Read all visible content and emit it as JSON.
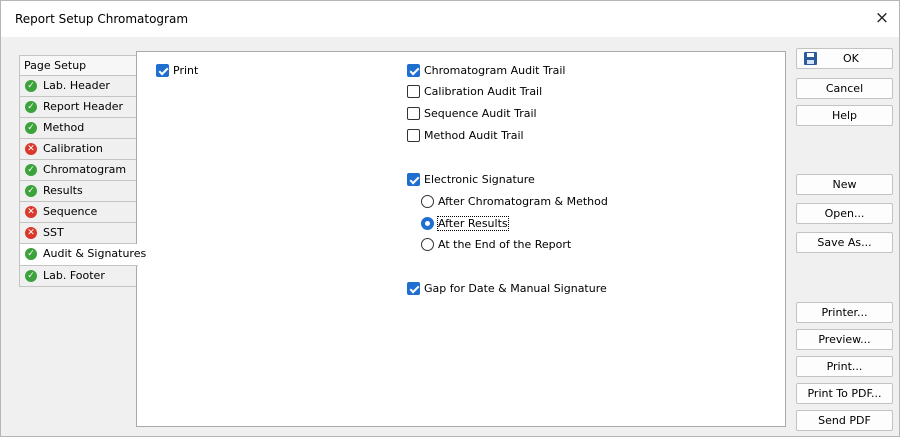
{
  "window": {
    "title": "Report Setup Chromatogram",
    "close_glyph": "×"
  },
  "tabs": [
    {
      "label": "Page Setup",
      "status": "none"
    },
    {
      "label": "Lab. Header",
      "status": "ok"
    },
    {
      "label": "Report Header",
      "status": "ok"
    },
    {
      "label": "Method",
      "status": "ok"
    },
    {
      "label": "Calibration",
      "status": "error"
    },
    {
      "label": "Chromatogram",
      "status": "ok"
    },
    {
      "label": "Results",
      "status": "ok"
    },
    {
      "label": "Sequence",
      "status": "error"
    },
    {
      "label": "SST",
      "status": "error"
    },
    {
      "label": "Audit & Signatures",
      "status": "ok",
      "active": true
    },
    {
      "label": "Lab. Footer",
      "status": "ok"
    }
  ],
  "icons": {
    "ok": "check-circle-icon",
    "error": "x-circle-icon",
    "ok_color": "#3ca23c",
    "error_color": "#d9382b"
  },
  "options": {
    "print": {
      "label": "Print",
      "checked": true
    },
    "chromatogram_audit_trail": {
      "label": "Chromatogram Audit Trail",
      "checked": true
    },
    "calibration_audit_trail": {
      "label": "Calibration Audit Trail",
      "checked": false
    },
    "sequence_audit_trail": {
      "label": "Sequence Audit Trail",
      "checked": false
    },
    "method_audit_trail": {
      "label": "Method Audit Trail",
      "checked": false
    },
    "electronic_signature": {
      "label": "Electronic Signature",
      "checked": true
    },
    "gap_signature": {
      "label": "Gap for Date & Manual Signature",
      "checked": true
    }
  },
  "signature_position": {
    "selected": "after_results",
    "choices": [
      {
        "id": "after_chromatogram_method",
        "label": "After Chromatogram & Method"
      },
      {
        "id": "after_results",
        "label": "After Results"
      },
      {
        "id": "end_of_report",
        "label": "At the End of the Report"
      }
    ]
  },
  "buttons": {
    "ok": "OK",
    "cancel": "Cancel",
    "help": "Help",
    "new": "New",
    "open": "Open...",
    "save_as": "Save As...",
    "printer": "Printer...",
    "preview": "Preview...",
    "print": "Print...",
    "print_to_pdf": "Print To PDF...",
    "send_pdf": "Send PDF"
  },
  "accent_color": "#1f6fd1"
}
